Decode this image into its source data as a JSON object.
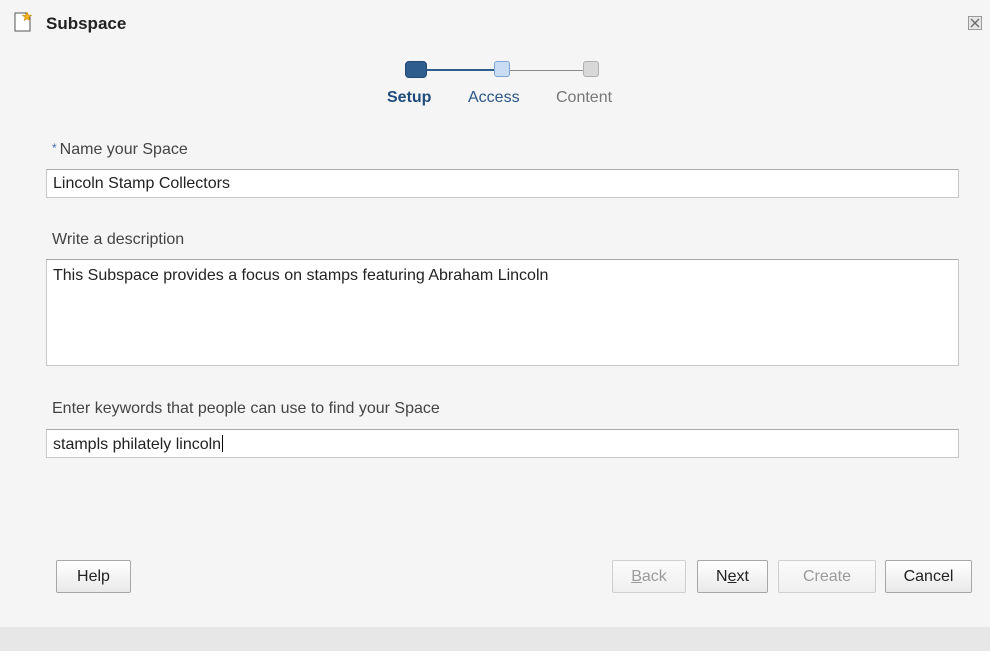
{
  "window": {
    "title": "Subspace",
    "icons": {
      "app": "new-document-star-icon",
      "close": "close-icon"
    }
  },
  "train": {
    "steps": [
      {
        "label": "Setup",
        "state": "current"
      },
      {
        "label": "Access",
        "state": "next"
      },
      {
        "label": "Content",
        "state": "inactive"
      }
    ],
    "colors": {
      "current": "#2f5d8e",
      "next": "#c9dcf4",
      "inactive": "#d8d8d8"
    }
  },
  "form": {
    "name": {
      "required_mark": "*",
      "label": "Name your Space",
      "value": "Lincoln Stamp Collectors"
    },
    "description": {
      "label": "Write a description",
      "value": "This Subspace provides a focus on stamps featuring Abraham Lincoln"
    },
    "keywords": {
      "label": "Enter keywords that people can use to find your Space",
      "value": "stampls philately lincoln"
    }
  },
  "buttons": {
    "help": "Help",
    "back": {
      "pre": "",
      "mnemonic": "B",
      "post": "ack",
      "enabled": false
    },
    "next": {
      "pre": "N",
      "mnemonic": "e",
      "post": "xt",
      "enabled": true
    },
    "create": {
      "label": "Create",
      "enabled": false
    },
    "cancel": "Cancel"
  }
}
